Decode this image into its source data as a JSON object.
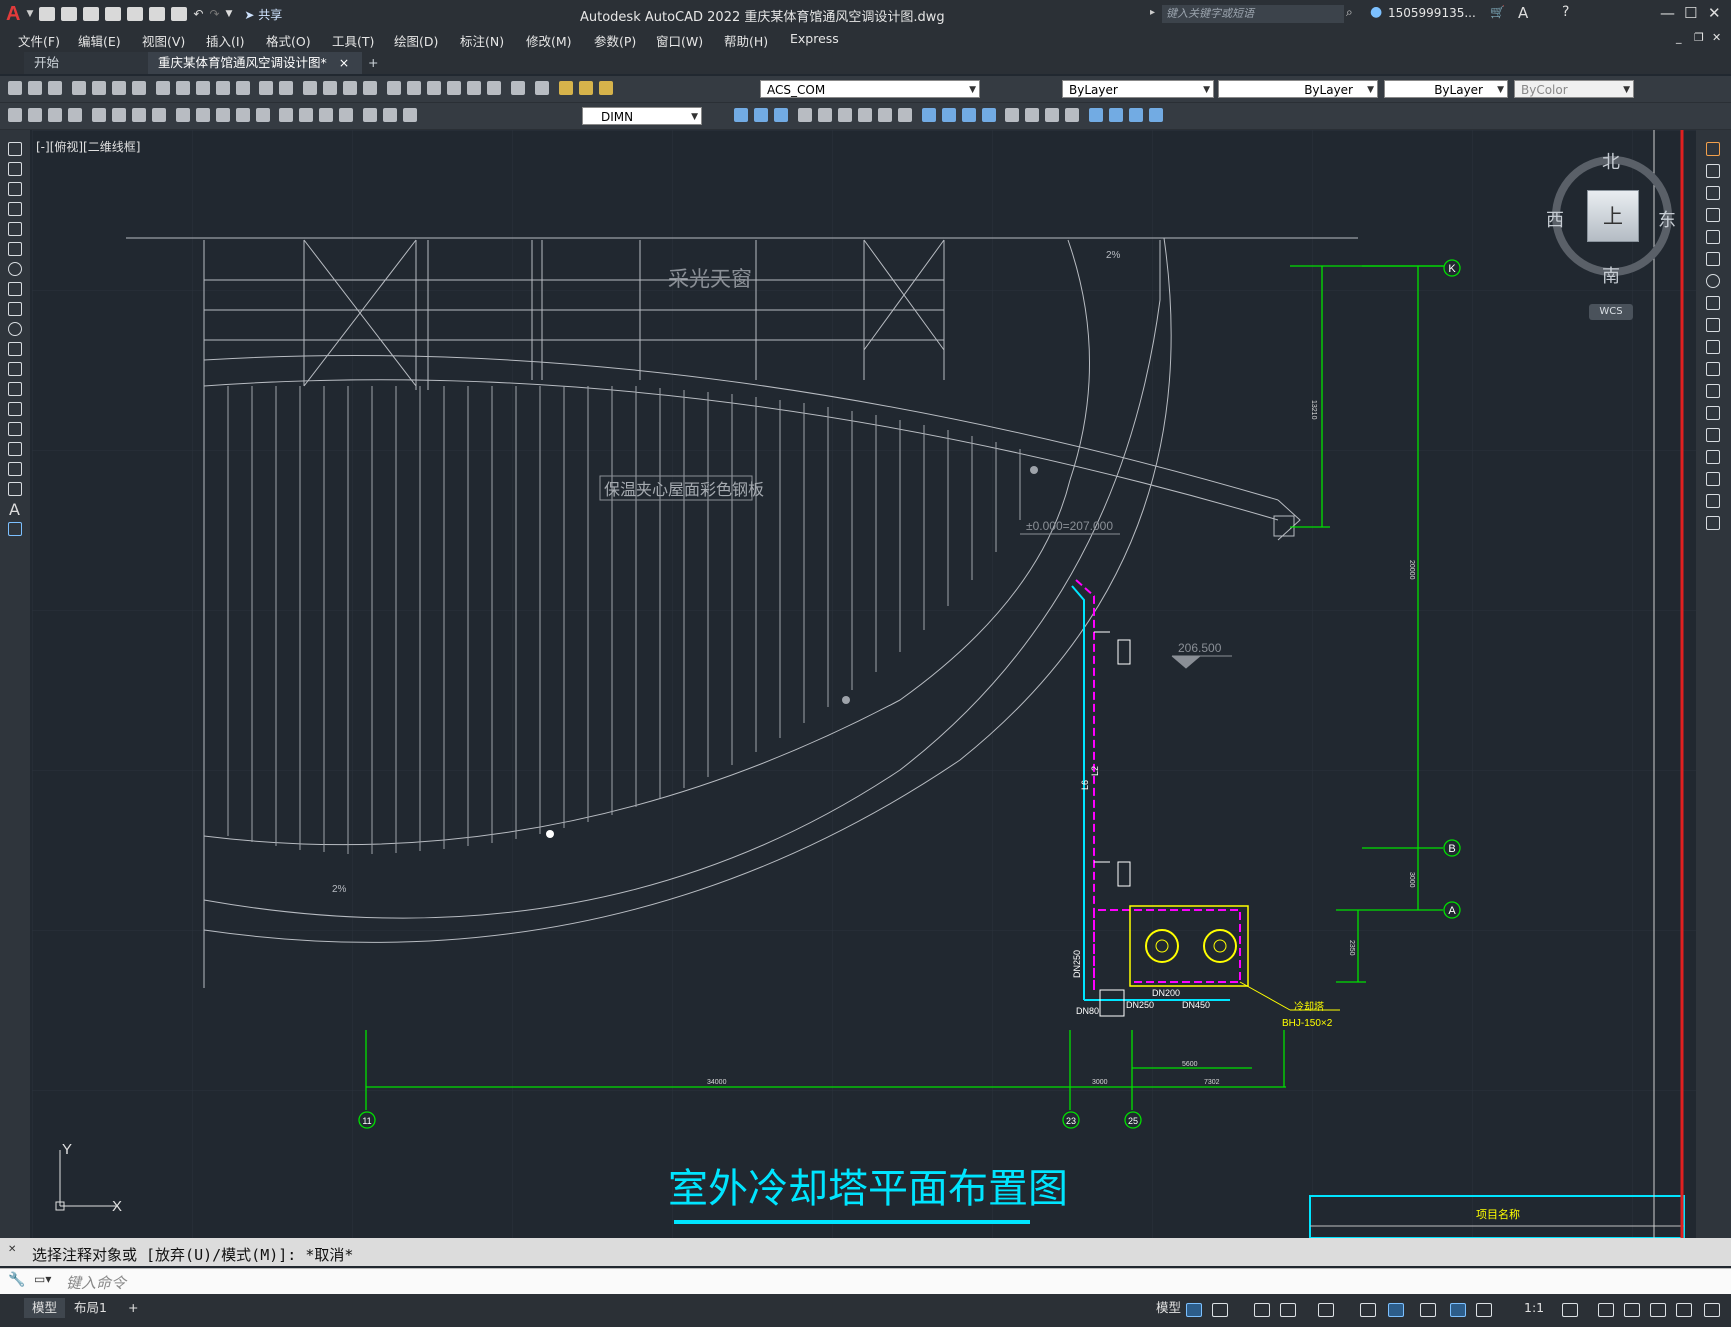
{
  "titlebar": {
    "app_logo": "A",
    "share_label": "共享",
    "title": "Autodesk AutoCAD 2022    重庆某体育馆通风空调设计图.dwg",
    "search_placeholder": "键入关键字或短语",
    "user": "1505999135..."
  },
  "menu": [
    "文件(F)",
    "编辑(E)",
    "视图(V)",
    "插入(I)",
    "格式(O)",
    "工具(T)",
    "绘图(D)",
    "标注(N)",
    "修改(M)",
    "参数(P)",
    "窗口(W)",
    "帮助(H)",
    "Express"
  ],
  "tabs": {
    "start": "开始",
    "doc": "重庆某体育馆通风空调设计图*",
    "close": "×",
    "add": "+"
  },
  "layers": {
    "current_layer": "ACS_COM",
    "color": "ByLayer",
    "linetype": "ByLayer",
    "lineweight": "ByLayer",
    "plotstyle": "ByColor",
    "dimstyle": "DIMN"
  },
  "viewport_label": "[-][俯视][二维线框]",
  "viewcube": {
    "north": "北",
    "south": "南",
    "east": "东",
    "west": "西",
    "face": "上",
    "wcs": "WCS"
  },
  "drawing": {
    "skylight": "采光天窗",
    "roof_panel": "保温夹心屋面彩色钢板",
    "slope_top": "2%",
    "slope_bottom": "2%",
    "elevation_1": "±0.000=207.000",
    "elevation_2": "206.500",
    "grid_k": "K",
    "grid_b": "B",
    "grid_a": "A",
    "grid_11": "11",
    "grid_23": "23",
    "grid_25": "25",
    "dim_13210": "13210",
    "dim_20000": "20000",
    "dim_3000v": "3000",
    "dim_2350": "2350",
    "dim_34000": "34000",
    "dim_3000h": "3000",
    "dim_7302": "7302",
    "dim_5600": "5600",
    "pipe_l": "L6",
    "pipe_l2": "L2",
    "dn250": "DN250",
    "dn200": "DN200",
    "dn450": "DN450",
    "dn80": "DN80",
    "dn250b": "DN250",
    "tower_label": "冷却塔",
    "tower_model": "BHJ-150×2",
    "main_title": "室外冷却塔平面布置图",
    "project_name": "项目名称"
  },
  "command": {
    "history": "选择注释对象或 [放弃(U)/模式(M)]: *取消*",
    "placeholder": "键入命令"
  },
  "status": {
    "model_tab": "模型",
    "layout_tab": "布局1",
    "add": "+",
    "model_btn": "模型",
    "scale": "1:1"
  },
  "colors": {
    "accent_red": "#e23b3b",
    "green_grid": "#00e000",
    "cyan": "#00e5ff",
    "magenta": "#ff00ff",
    "yellow": "#ffff00"
  }
}
